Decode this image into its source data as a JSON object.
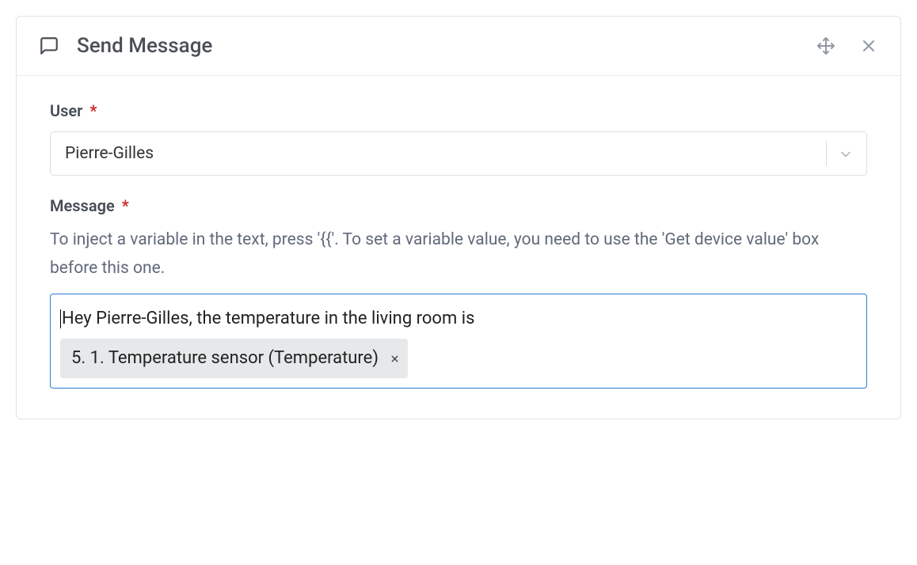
{
  "header": {
    "title": "Send Message"
  },
  "form": {
    "user": {
      "label": "User",
      "selected": "Pierre-Gilles"
    },
    "message": {
      "label": "Message",
      "help_text": "To inject a variable in the text, press '{{'. To set a variable value, you need to use the 'Get device value' box before this one.",
      "body_text": "Hey Pierre-Gilles, the temperature in the living room is",
      "variable_tag": "5. 1. Temperature sensor (Temperature)"
    }
  }
}
